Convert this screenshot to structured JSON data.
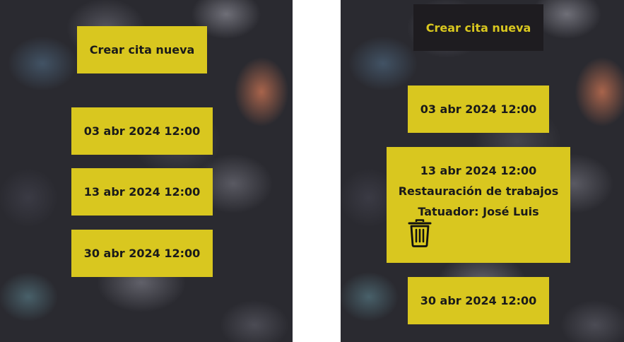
{
  "left": {
    "create_button": "Crear cita nueva",
    "appointments": [
      {
        "date": "03 abr 2024 12:00"
      },
      {
        "date": "13 abr 2024 12:00"
      },
      {
        "date": "30 abr 2024 12:00"
      }
    ]
  },
  "right": {
    "create_button": "Crear cita nueva",
    "appointments": [
      {
        "date": "03 abr 2024 12:00"
      },
      {
        "date": "13 abr 2024 12:00",
        "service": "Restauración de trabajos",
        "artist": "Tatuador: José Luis",
        "delete_icon": "trash-icon"
      },
      {
        "date": "30 abr 2024 12:00"
      }
    ]
  },
  "colors": {
    "accent": "#d9c71f",
    "dark_button": "#1e1c20",
    "text": "#1a1a1a"
  }
}
